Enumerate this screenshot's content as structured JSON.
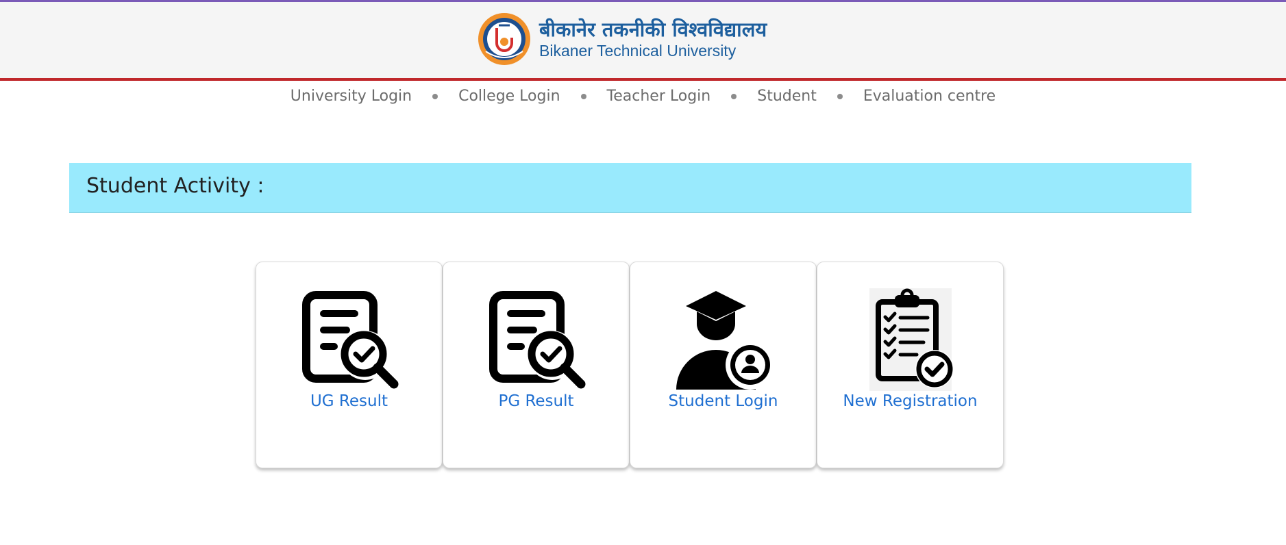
{
  "header": {
    "title_hindi": "बीकानेर तकनीकी विश्वविद्यालय",
    "title_english": "Bikaner Technical University",
    "colors": {
      "top_line": "#7b5bb8",
      "bottom_line": "#c0282b",
      "brand_text": "#1d5f9e"
    }
  },
  "nav": {
    "items": [
      {
        "label": "University Login"
      },
      {
        "label": "College Login"
      },
      {
        "label": "Teacher Login"
      },
      {
        "label": "Student"
      },
      {
        "label": "Evaluation centre"
      }
    ]
  },
  "activity": {
    "title": "Student Activity :",
    "background": "#99eafd"
  },
  "cards": [
    {
      "label": "UG Result",
      "icon": "document-search-check-icon"
    },
    {
      "label": "PG Result",
      "icon": "document-search-check-icon"
    },
    {
      "label": "Student Login",
      "icon": "graduate-user-icon"
    },
    {
      "label": "New Registration",
      "icon": "clipboard-checklist-icon"
    }
  ]
}
